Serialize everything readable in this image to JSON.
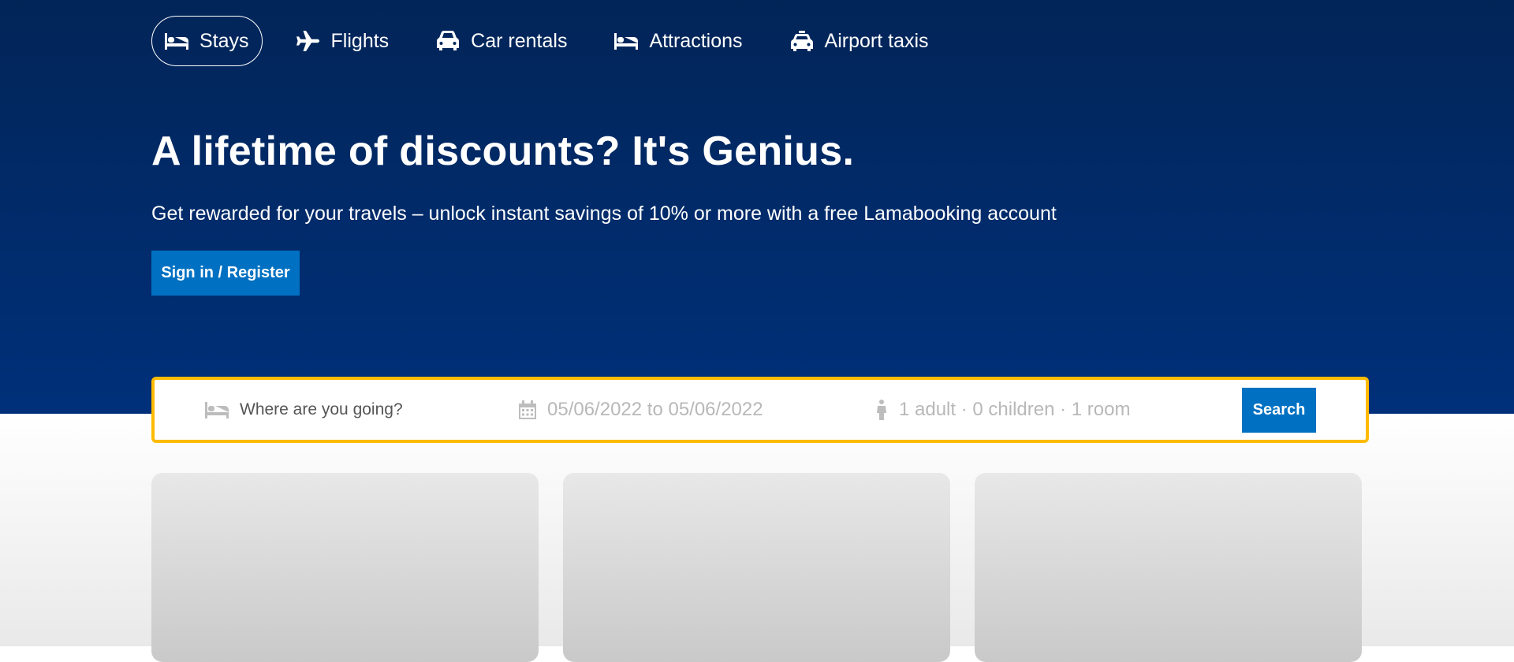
{
  "nav": {
    "items": [
      {
        "label": "Stays",
        "icon": "bed-icon",
        "active": true
      },
      {
        "label": "Flights",
        "icon": "plane-icon"
      },
      {
        "label": "Car rentals",
        "icon": "car-icon"
      },
      {
        "label": "Attractions",
        "icon": "bed-icon"
      },
      {
        "label": "Airport taxis",
        "icon": "taxi-icon"
      }
    ]
  },
  "hero": {
    "title": "A lifetime of discounts? It's Genius.",
    "subtitle": "Get rewarded for your travels – unlock instant savings of 10% or more with a free Lamabooking account",
    "signin_label": "Sign in / Register"
  },
  "search": {
    "destination_placeholder": "Where are you going?",
    "dates": "05/06/2022 to 05/06/2022",
    "guests": "1 adult · 0 children · 1 room",
    "button_label": "Search",
    "border_color": "#febb02"
  },
  "colors": {
    "hero_bg": "#003580",
    "primary_button": "#0071c2"
  }
}
